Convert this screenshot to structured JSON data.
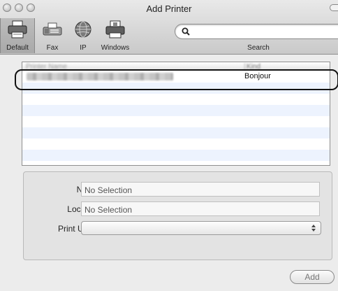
{
  "window": {
    "title": "Add Printer"
  },
  "toolbar": {
    "items": [
      {
        "label": "Default",
        "icon": "default-printer-icon",
        "selected": true
      },
      {
        "label": "Fax",
        "icon": "fax-icon",
        "selected": false
      },
      {
        "label": "IP",
        "icon": "globe-icon",
        "selected": false
      },
      {
        "label": "Windows",
        "icon": "windows-printer-icon",
        "selected": false
      }
    ],
    "search": {
      "label": "Search",
      "value": ""
    }
  },
  "printer_list": {
    "columns": [
      "Printer Name",
      "Kind"
    ],
    "rows": [
      {
        "name": "",
        "kind": "Bonjour"
      },
      {
        "name": "",
        "kind": ""
      },
      {
        "name": "",
        "kind": ""
      },
      {
        "name": "",
        "kind": ""
      },
      {
        "name": "",
        "kind": ""
      },
      {
        "name": "",
        "kind": ""
      },
      {
        "name": "",
        "kind": ""
      },
      {
        "name": "",
        "kind": ""
      }
    ]
  },
  "details": {
    "name": {
      "label": "Name:",
      "value": "No Selection"
    },
    "location": {
      "label": "Location:",
      "value": "No Selection"
    },
    "print_using": {
      "label": "Print Using:",
      "value": ""
    }
  },
  "buttons": {
    "add": "Add"
  },
  "colors": {
    "stripe": "#edf3fe",
    "highlight_ring": "#111111"
  }
}
